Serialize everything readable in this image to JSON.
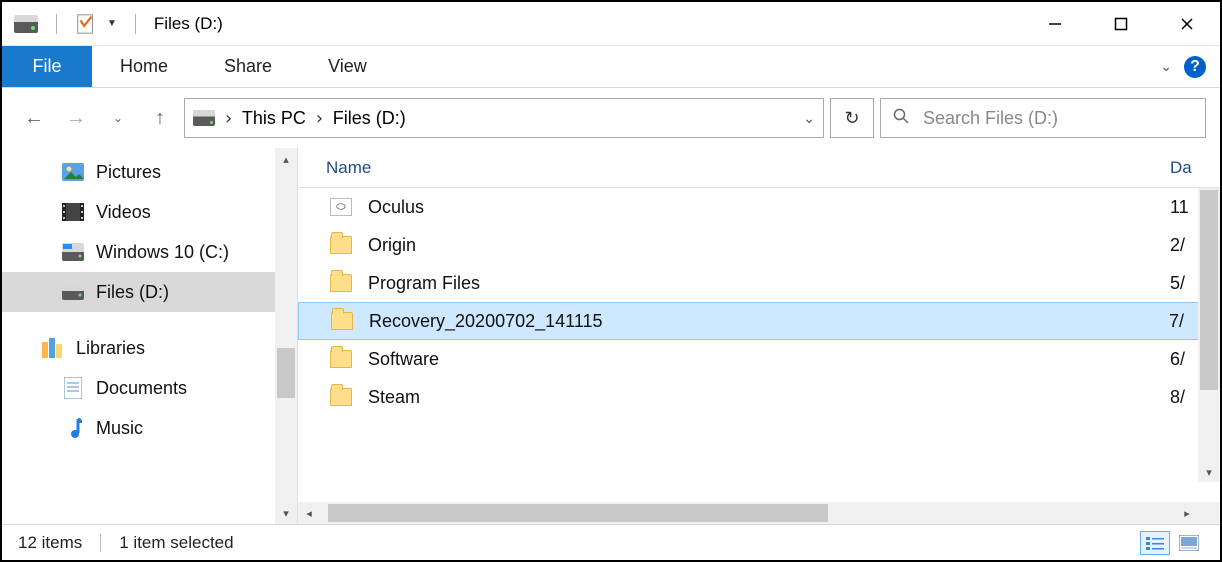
{
  "title": "Files (D:)",
  "ribbon": {
    "file": "File",
    "tabs": [
      "Home",
      "Share",
      "View"
    ]
  },
  "breadcrumb": {
    "items": [
      "This PC",
      "Files (D:)"
    ]
  },
  "search": {
    "placeholder": "Search Files (D:)"
  },
  "sidebar": {
    "items": [
      {
        "label": "Pictures",
        "icon": "pictures",
        "indent": "child"
      },
      {
        "label": "Videos",
        "icon": "videos",
        "indent": "child"
      },
      {
        "label": "Windows 10 (C:)",
        "icon": "drive-c",
        "indent": "child"
      },
      {
        "label": "Files (D:)",
        "icon": "drive-d",
        "indent": "child",
        "selected": true
      },
      {
        "label": "Libraries",
        "icon": "libraries",
        "indent": "top"
      },
      {
        "label": "Documents",
        "icon": "documents",
        "indent": "child"
      },
      {
        "label": "Music",
        "icon": "music",
        "indent": "child"
      }
    ]
  },
  "columns": {
    "name": "Name",
    "date": "Da"
  },
  "files": [
    {
      "name": "Oculus",
      "icon": "oculus",
      "date": "11"
    },
    {
      "name": "Origin",
      "icon": "folder",
      "date": "2/"
    },
    {
      "name": "Program Files",
      "icon": "folder",
      "date": "5/"
    },
    {
      "name": "Recovery_20200702_141115",
      "icon": "folder",
      "date": "7/",
      "selected": true
    },
    {
      "name": "Software",
      "icon": "folder",
      "date": "6/"
    },
    {
      "name": "Steam",
      "icon": "folder",
      "date": "8/"
    }
  ],
  "status": {
    "count": "12 items",
    "selection": "1 item selected"
  }
}
